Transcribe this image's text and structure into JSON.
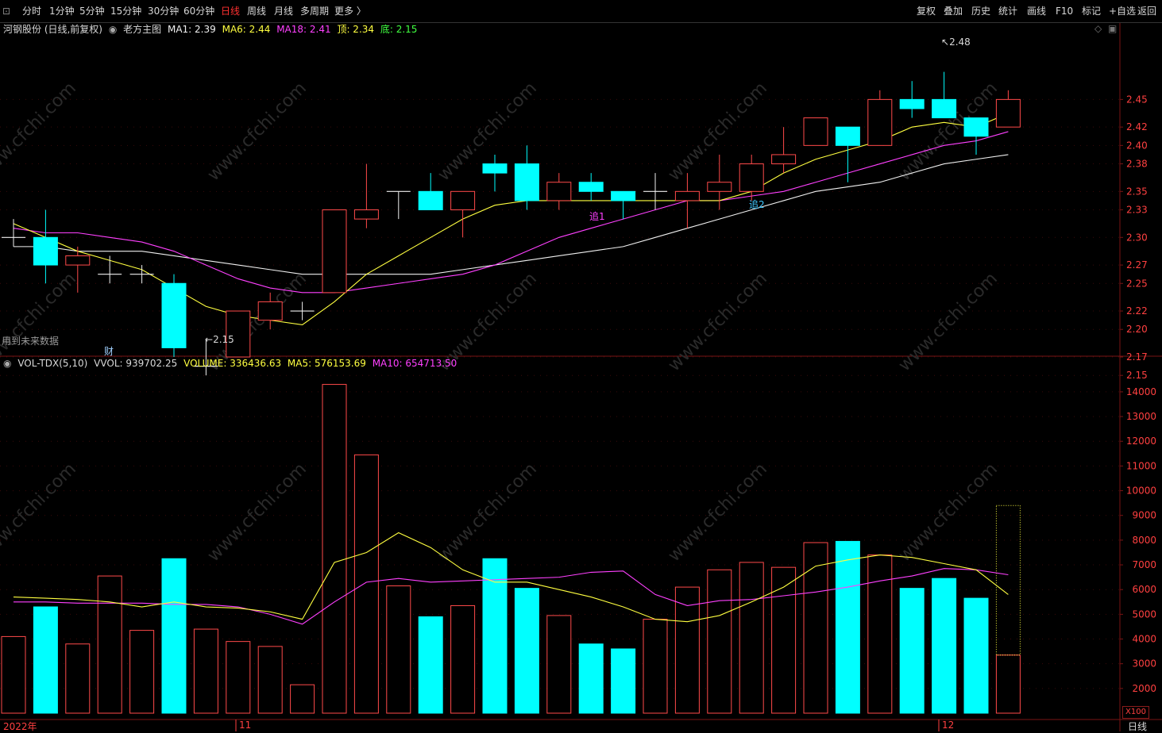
{
  "toolbar": {
    "periods": [
      "分时",
      "1分钟",
      "5分钟",
      "15分钟",
      "30分钟",
      "60分钟",
      "日线",
      "周线",
      "月线",
      "多周期",
      "更多 〉"
    ],
    "active_period": "日线",
    "actions": [
      "复权",
      "叠加",
      "历史",
      "统计",
      "画线",
      "F10",
      "标记",
      "+自选",
      "返回"
    ]
  },
  "main_legend": {
    "stock": "河钢股份 (日线,前复权)",
    "indicator": "老方主图",
    "ma1": "MA1: 2.39",
    "ma6": "MA6: 2.44",
    "ma18": "MA18: 2.41",
    "top": "顶: 2.34",
    "bottom": "底: 2.15"
  },
  "vol_legend": {
    "name": "VOL-TDX(5,10)",
    "vvol": "VVOL: 939702.25",
    "volume": "VOLUME: 336436.63",
    "ma5": "MA5: 576153.69",
    "ma10": "MA10: 654713.50"
  },
  "annotations": {
    "future_data": "用到未来数据",
    "cai": "财",
    "zhui1": "追1",
    "zhui2": "追2",
    "high_label": "2.48",
    "low_label": "2.15"
  },
  "axis": {
    "x_labels": [
      "2022年",
      "11",
      "12"
    ],
    "x100": "X100",
    "period": "日线"
  },
  "colors": {
    "up": "#ff4a4a",
    "down": "#00ffff",
    "ma_white": "#f0f0f0",
    "ma_yellow": "#ffff40",
    "ma_magenta": "#ff40ff"
  },
  "chart_data": {
    "type": "candlestick",
    "price_axis_ticks": [
      2.15,
      2.17,
      2.2,
      2.22,
      2.25,
      2.27,
      2.3,
      2.33,
      2.35,
      2.38,
      2.4,
      2.42,
      2.45
    ],
    "volume_axis_ticks": [
      2000,
      3000,
      4000,
      5000,
      6000,
      7000,
      8000,
      9000,
      10000,
      11000,
      12000,
      13000,
      14000
    ],
    "candles": [
      {
        "o": 2.3,
        "h": 2.32,
        "l": 2.29,
        "c": 2.3
      },
      {
        "o": 2.3,
        "h": 2.33,
        "l": 2.25,
        "c": 2.27
      },
      {
        "o": 2.27,
        "h": 2.29,
        "l": 2.24,
        "c": 2.28
      },
      {
        "o": 2.26,
        "h": 2.28,
        "l": 2.25,
        "c": 2.26
      },
      {
        "o": 2.26,
        "h": 2.27,
        "l": 2.25,
        "c": 2.26
      },
      {
        "o": 2.25,
        "h": 2.26,
        "l": 2.17,
        "c": 2.18
      },
      {
        "o": 2.16,
        "h": 2.19,
        "l": 2.15,
        "c": 2.16
      },
      {
        "o": 2.17,
        "h": 2.22,
        "l": 2.17,
        "c": 2.22
      },
      {
        "o": 2.21,
        "h": 2.24,
        "l": 2.2,
        "c": 2.23
      },
      {
        "o": 2.22,
        "h": 2.23,
        "l": 2.21,
        "c": 2.22
      },
      {
        "o": 2.24,
        "h": 2.33,
        "l": 2.24,
        "c": 2.33
      },
      {
        "o": 2.32,
        "h": 2.38,
        "l": 2.31,
        "c": 2.33
      },
      {
        "o": 2.35,
        "h": 2.35,
        "l": 2.32,
        "c": 2.35
      },
      {
        "o": 2.35,
        "h": 2.37,
        "l": 2.33,
        "c": 2.33
      },
      {
        "o": 2.33,
        "h": 2.35,
        "l": 2.3,
        "c": 2.35
      },
      {
        "o": 2.38,
        "h": 2.39,
        "l": 2.35,
        "c": 2.37
      },
      {
        "o": 2.38,
        "h": 2.4,
        "l": 2.33,
        "c": 2.34
      },
      {
        "o": 2.34,
        "h": 2.37,
        "l": 2.33,
        "c": 2.36
      },
      {
        "o": 2.36,
        "h": 2.37,
        "l": 2.34,
        "c": 2.35
      },
      {
        "o": 2.35,
        "h": 2.35,
        "l": 2.32,
        "c": 2.34
      },
      {
        "o": 2.35,
        "h": 2.37,
        "l": 2.33,
        "c": 2.35
      },
      {
        "o": 2.34,
        "h": 2.37,
        "l": 2.31,
        "c": 2.35
      },
      {
        "o": 2.35,
        "h": 2.39,
        "l": 2.33,
        "c": 2.36
      },
      {
        "o": 2.35,
        "h": 2.39,
        "l": 2.34,
        "c": 2.38
      },
      {
        "o": 2.38,
        "h": 2.42,
        "l": 2.37,
        "c": 2.39
      },
      {
        "o": 2.4,
        "h": 2.43,
        "l": 2.4,
        "c": 2.43
      },
      {
        "o": 2.42,
        "h": 2.42,
        "l": 2.36,
        "c": 2.4
      },
      {
        "o": 2.4,
        "h": 2.46,
        "l": 2.4,
        "c": 2.45
      },
      {
        "o": 2.45,
        "h": 2.47,
        "l": 2.43,
        "c": 2.44
      },
      {
        "o": 2.45,
        "h": 2.48,
        "l": 2.43,
        "c": 2.43
      },
      {
        "o": 2.43,
        "h": 2.43,
        "l": 2.39,
        "c": 2.41
      },
      {
        "o": 2.42,
        "h": 2.46,
        "l": 2.42,
        "c": 2.45
      }
    ],
    "volumes": [
      4100,
      5300,
      3800,
      6550,
      4350,
      7250,
      4400,
      3900,
      3700,
      2150,
      14300,
      11450,
      6150,
      4900,
      5350,
      7250,
      6050,
      4950,
      3800,
      3600,
      4800,
      6100,
      6800,
      7100,
      6900,
      7900,
      7950,
      7400,
      6050,
      6450,
      5650,
      3350
    ],
    "last_volume_projection": 9400,
    "ma_white": [
      2.29,
      2.29,
      2.285,
      2.285,
      2.285,
      2.28,
      2.275,
      2.27,
      2.265,
      2.26,
      2.26,
      2.26,
      2.26,
      2.26,
      2.265,
      2.27,
      2.275,
      2.28,
      2.285,
      2.29,
      2.3,
      2.31,
      2.32,
      2.33,
      2.34,
      2.35,
      2.355,
      2.36,
      2.37,
      2.38,
      2.385,
      2.39
    ],
    "ma_yellow": [
      2.315,
      2.3,
      2.285,
      2.275,
      2.265,
      2.245,
      2.225,
      2.215,
      2.21,
      2.205,
      2.23,
      2.26,
      2.28,
      2.3,
      2.32,
      2.335,
      2.34,
      2.34,
      2.34,
      2.34,
      2.34,
      2.34,
      2.34,
      2.35,
      2.37,
      2.385,
      2.395,
      2.405,
      2.42,
      2.425,
      2.42,
      2.435
    ],
    "ma_magenta": [
      2.31,
      2.305,
      2.305,
      2.3,
      2.295,
      2.285,
      2.27,
      2.255,
      2.245,
      2.24,
      2.24,
      2.245,
      2.25,
      2.255,
      2.26,
      2.27,
      2.285,
      2.3,
      2.31,
      2.32,
      2.33,
      2.34,
      2.34,
      2.345,
      2.35,
      2.36,
      2.37,
      2.38,
      2.39,
      2.4,
      2.405,
      2.415
    ],
    "vol_ma5": [
      5700,
      5650,
      5600,
      5500,
      5300,
      5500,
      5300,
      5250,
      5100,
      4800,
      7100,
      7500,
      8300,
      7700,
      6800,
      6300,
      6300,
      6000,
      5700,
      5300,
      4800,
      4700,
      4950,
      5500,
      6100,
      6950,
      7200,
      7400,
      7300,
      7050,
      6800,
      5800
    ],
    "vol_ma10": [
      5500,
      5500,
      5450,
      5450,
      5450,
      5400,
      5400,
      5300,
      5000,
      4600,
      5500,
      6300,
      6450,
      6300,
      6350,
      6400,
      6450,
      6500,
      6700,
      6750,
      5800,
      5350,
      5550,
      5600,
      5750,
      5900,
      6100,
      6350,
      6550,
      6850,
      6800,
      6600
    ]
  }
}
